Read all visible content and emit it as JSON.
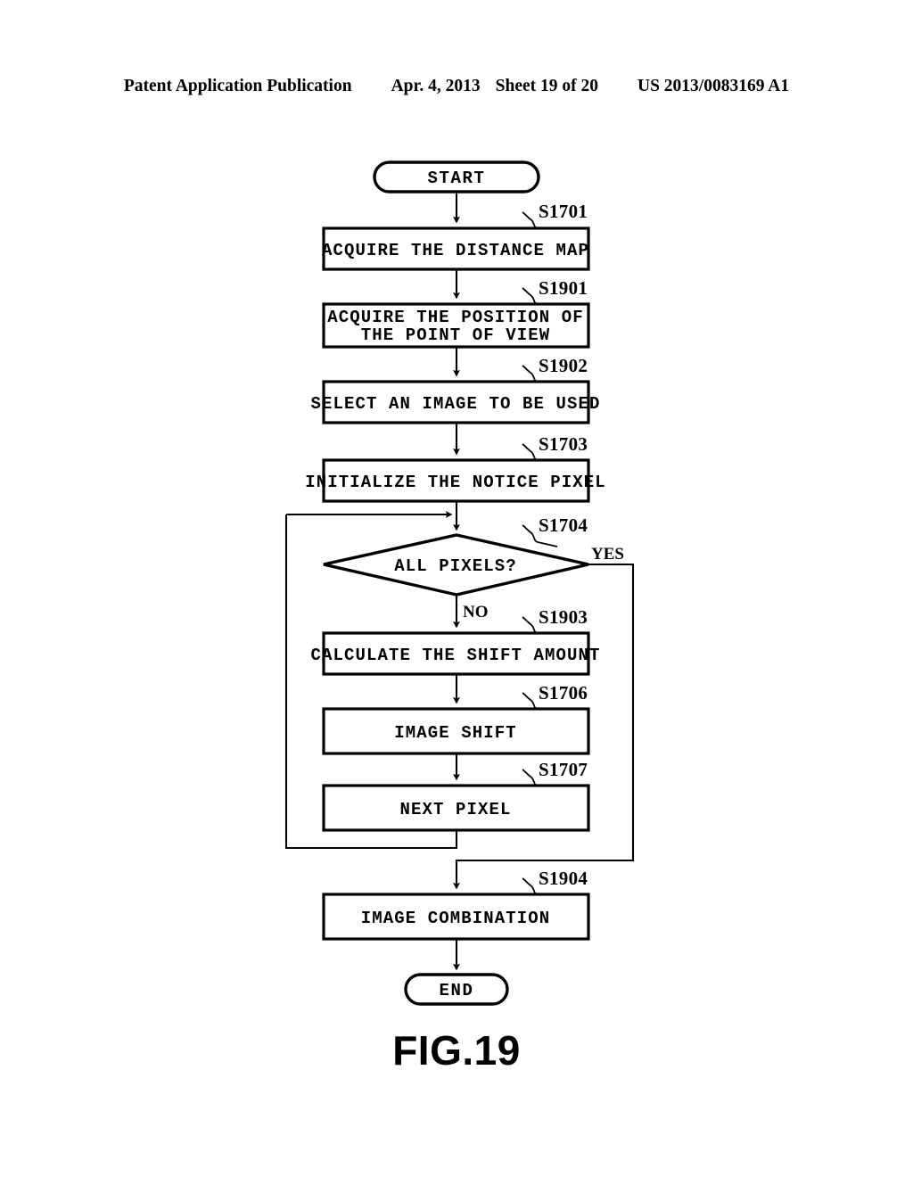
{
  "header": {
    "publication": "Patent Application Publication",
    "date": "Apr. 4, 2013",
    "sheet": "Sheet 19 of 20",
    "number": "US 2013/0083169 A1"
  },
  "figure": {
    "label": "FIG.19"
  },
  "flowchart": {
    "start": {
      "label": "START"
    },
    "end": {
      "label": "END"
    },
    "steps": [
      {
        "id": "S1701",
        "text": "ACQUIRE THE DISTANCE MAP"
      },
      {
        "id": "S1901",
        "text_line1": "ACQUIRE THE POSITION OF",
        "text_line2": "THE POINT OF VIEW"
      },
      {
        "id": "S1902",
        "text": "SELECT AN IMAGE TO BE USED"
      },
      {
        "id": "S1703",
        "text": "INITIALIZE THE NOTICE PIXEL"
      },
      {
        "id": "S1704",
        "text": "ALL PIXELS?"
      },
      {
        "id": "S1903",
        "text": "CALCULATE THE SHIFT AMOUNT"
      },
      {
        "id": "S1706",
        "text": "IMAGE SHIFT"
      },
      {
        "id": "S1707",
        "text": "NEXT PIXEL"
      },
      {
        "id": "S1904",
        "text": "IMAGE COMBINATION"
      }
    ],
    "branches": {
      "yes": "YES",
      "no": "NO"
    }
  },
  "colors": {
    "ink": "#000000",
    "paper": "#ffffff"
  }
}
